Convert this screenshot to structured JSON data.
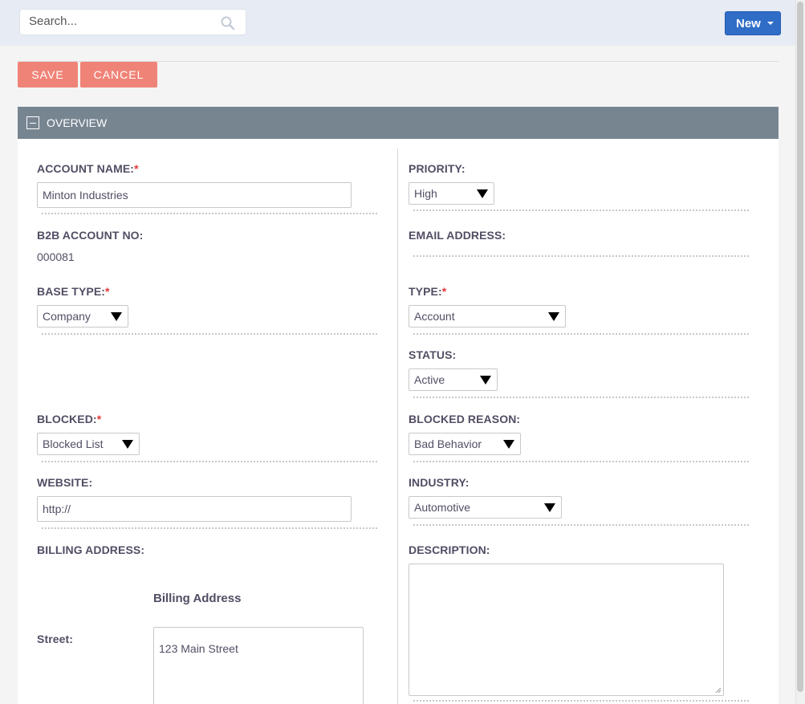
{
  "header": {
    "search_placeholder": "Search...",
    "new_label": "New"
  },
  "actions": {
    "save_label": "SAVE",
    "cancel_label": "CANCEL"
  },
  "panel": {
    "title": "OVERVIEW"
  },
  "fields": {
    "account_name": {
      "label": "ACCOUNT NAME:",
      "required": "*",
      "value": "Minton Industries"
    },
    "priority": {
      "label": "PRIORITY:",
      "value": "High"
    },
    "b2b_account_no": {
      "label": "B2B ACCOUNT NO:",
      "value": "000081"
    },
    "email_address": {
      "label": "EMAIL ADDRESS:"
    },
    "base_type": {
      "label": "BASE TYPE:",
      "required": "*",
      "value": "Company"
    },
    "type": {
      "label": "TYPE:",
      "required": "*",
      "value": "Account"
    },
    "status": {
      "label": "STATUS:",
      "value": "Active"
    },
    "blocked": {
      "label": "BLOCKED:",
      "required": "*",
      "value": "Blocked List"
    },
    "blocked_reason": {
      "label": "BLOCKED REASON:",
      "value": "Bad Behavior"
    },
    "website": {
      "label": "WEBSITE:",
      "value": "http://"
    },
    "industry": {
      "label": "INDUSTRY:",
      "value": "Automotive"
    },
    "billing_address": {
      "label": "BILLING ADDRESS:",
      "subheading": "Billing Address",
      "street_label": "Street:",
      "street_value": "123 Main Street"
    },
    "description": {
      "label": "DESCRIPTION:",
      "value": ""
    }
  },
  "icons": {
    "search": "search-icon",
    "collapse": "minus-box-icon",
    "dropdown": "caret-down-icon"
  },
  "colors": {
    "accent": "#2f6dc7",
    "button": "#f08377",
    "panel_header": "#778591",
    "required": "#e03a3a"
  }
}
